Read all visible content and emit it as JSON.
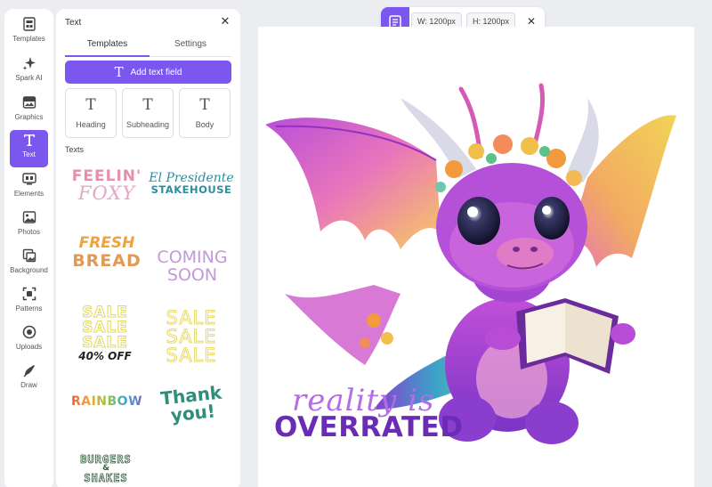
{
  "rail": {
    "items": [
      {
        "label": "Templates",
        "icon": "templates-icon"
      },
      {
        "label": "Spark AI",
        "icon": "sparkle-icon"
      },
      {
        "label": "Graphics",
        "icon": "graphics-icon"
      },
      {
        "label": "Text",
        "icon": "text-icon",
        "active": true
      },
      {
        "label": "Elements",
        "icon": "elements-icon"
      },
      {
        "label": "Photos",
        "icon": "photos-icon"
      },
      {
        "label": "Background",
        "icon": "background-icon"
      },
      {
        "label": "Patterns",
        "icon": "patterns-icon"
      },
      {
        "label": "Uploads",
        "icon": "uploads-icon"
      },
      {
        "label": "Draw",
        "icon": "draw-icon"
      }
    ]
  },
  "panel": {
    "title": "Text",
    "close": "✕",
    "tabs": [
      "Templates",
      "Settings"
    ],
    "add_label": "Add text field",
    "styles": [
      {
        "label": "Heading",
        "glyph": "T"
      },
      {
        "label": "Subheading",
        "glyph": "T"
      },
      {
        "label": "Body",
        "glyph": "T"
      }
    ],
    "section_label": "Texts",
    "templates": {
      "feelin": "FEELIN'",
      "foxy": "FOXY",
      "el_presidente": "El Presidente",
      "stakehouse": "STAKEHOUSE",
      "fresh": "FRESH",
      "bread": "BREAD",
      "coming": "COMING",
      "soon": "SOON",
      "sale": "SALE",
      "off": "40% OFF",
      "rainbow": "RAINBOW",
      "thank": "Thank",
      "you": "you!",
      "burgers": "BURGERS",
      "amp": "&",
      "shakes": "SHAKES"
    }
  },
  "toolbar": {
    "width": "W: 1200px",
    "height": "H: 1200px",
    "close": "✕"
  },
  "canvas": {
    "slogan_line1": "reality is",
    "slogan_line2": "OVERRATED"
  },
  "colors": {
    "accent": "#7b56ef",
    "slogan_light": "#b36ee6",
    "slogan_dark": "#6a2cb4"
  }
}
